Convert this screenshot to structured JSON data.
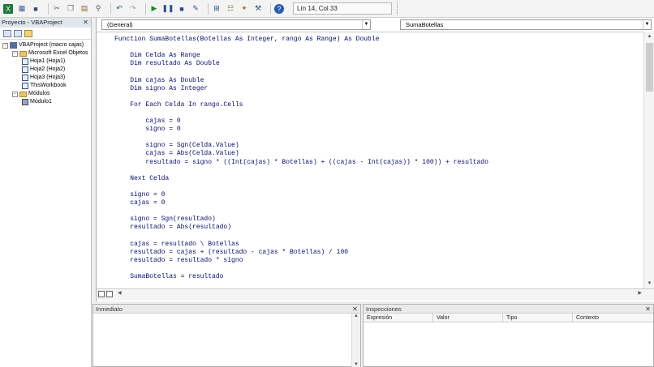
{
  "toolbar": {
    "status_text": "Lín 14, Col 33",
    "icons": [
      "excel-icon",
      "insert-module-icon",
      "save-icon",
      "cut-icon",
      "copy-icon",
      "paste-icon",
      "find-icon",
      "undo-icon",
      "redo-icon",
      "run-icon",
      "break-icon",
      "reset-icon",
      "design-mode-icon",
      "project-explorer-icon",
      "properties-icon",
      "object-browser-icon",
      "toolbox-icon",
      "help-icon"
    ]
  },
  "project": {
    "title": "Proyecto - VBAProject",
    "tree": [
      {
        "label": "VBAProject (macro cajas)",
        "level": 0,
        "icon": "project-icon",
        "expander": "-"
      },
      {
        "label": "Microsoft Excel Objetos",
        "level": 1,
        "icon": "folder-icon",
        "expander": "-"
      },
      {
        "label": "Hoja1 (Hoja1)",
        "level": 2,
        "icon": "sheet-icon",
        "expander": ""
      },
      {
        "label": "Hoja2 (Hoja2)",
        "level": 2,
        "icon": "sheet-icon",
        "expander": ""
      },
      {
        "label": "Hoja3 (Hoja3)",
        "level": 2,
        "icon": "sheet-icon",
        "expander": ""
      },
      {
        "label": "ThisWorkbook",
        "level": 2,
        "icon": "sheet-icon",
        "expander": ""
      },
      {
        "label": "Módulos",
        "level": 1,
        "icon": "folder-icon",
        "expander": "-"
      },
      {
        "label": "Módulo1",
        "level": 2,
        "icon": "module-icon",
        "expander": ""
      }
    ]
  },
  "code": {
    "object_combo": "(General)",
    "procedure_combo": "SumaBotellas",
    "lines": [
      "Function SumaBotellas(Botellas As Integer, rango As Range) As Double",
      "",
      "    Dim Celda As Range",
      "    Dim resultado As Double",
      "",
      "    Dim cajas As Double",
      "    Dim signo As Integer",
      "",
      "    For Each Celda In rango.Cells",
      "",
      "        cajas = 0",
      "        signo = 0",
      "",
      "        signo = Sgn(Celda.Value)",
      "        cajas = Abs(Celda.Value)",
      "        resultado = signo * ((Int(cajas) * Botellas) + ((cajas - Int(cajas)) * 100)) + resultado",
      "",
      "    Next Celda",
      "",
      "    signo = 0",
      "    cajas = 0",
      "",
      "    signo = Sgn(resultado)",
      "    resultado = Abs(resultado)",
      "",
      "    cajas = resultado \\ Botellas",
      "    resultado = cajas + (resultado - cajas * Botellas) / 100",
      "    resultado = resultado * signo",
      "",
      "    SumaBotellas = resultado"
    ]
  },
  "immediate": {
    "title": "Inmediato"
  },
  "watches": {
    "title": "Inspecciones",
    "columns": [
      "Expresión",
      "Valor",
      "Tipo",
      "Contexto"
    ]
  }
}
